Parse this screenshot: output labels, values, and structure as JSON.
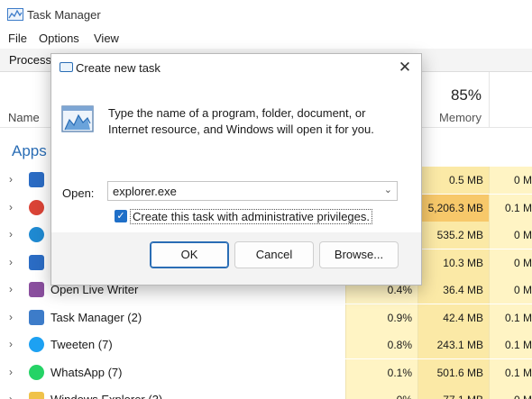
{
  "app": {
    "title": "Task Manager",
    "menus": [
      "File",
      "Options",
      "View"
    ],
    "tab": "Processe"
  },
  "columns": {
    "name": "Name",
    "memory_pct": "85%",
    "memory_label": "Memory"
  },
  "group": "Apps",
  "rows": [
    {
      "name": "",
      "cpu": "",
      "memory": "0.5 MB",
      "disk": "0 M",
      "icon": "blue-app-icon",
      "icon_color": "#2b6cc4"
    },
    {
      "name": "",
      "cpu": "",
      "memory": "5,206.3 MB",
      "disk": "0.1 M",
      "icon": "chrome-icon",
      "icon_color": "#db4437"
    },
    {
      "name": "",
      "cpu": "",
      "memory": "535.2 MB",
      "disk": "0 M",
      "icon": "edge-icon",
      "icon_color": "#1f8ad2"
    },
    {
      "name": "",
      "cpu": "",
      "memory": "10.3 MB",
      "disk": "0 M",
      "icon": "blue-app-icon",
      "icon_color": "#2b6cc4"
    },
    {
      "name": "Open Live Writer",
      "cpu": "0.4%",
      "memory": "36.4 MB",
      "disk": "0 M",
      "icon": "open-live-writer-icon",
      "icon_color": "#8a4f9e"
    },
    {
      "name": "Task Manager (2)",
      "cpu": "0.9%",
      "memory": "42.4 MB",
      "disk": "0.1 M",
      "icon": "task-manager-icon",
      "icon_color": "#3d7cc9"
    },
    {
      "name": "Tweeten (7)",
      "cpu": "0.8%",
      "memory": "243.1 MB",
      "disk": "0.1 M",
      "icon": "tweeten-icon",
      "icon_color": "#1da1f2"
    },
    {
      "name": "WhatsApp (7)",
      "cpu": "0.1%",
      "memory": "501.6 MB",
      "disk": "0.1 M",
      "icon": "whatsapp-icon",
      "icon_color": "#25d366"
    },
    {
      "name": "Windows Explorer (3)",
      "cpu": "0%",
      "memory": "77.1 MB",
      "disk": "0 M",
      "icon": "folder-icon",
      "icon_color": "#f0c24a"
    }
  ],
  "colors": {
    "accent": "#1f6fc8",
    "cpu_cell": "#fff4c4",
    "memory_cell": "#fbe9a6",
    "memory_cell_high": "#f7c86a",
    "disk_cell": "#fff4c4"
  },
  "dialog": {
    "title": "Create new task",
    "close_glyph": "✕",
    "description": "Type the name of a program, folder, document, or Internet resource, and Windows will open it for you.",
    "open_label": "Open:",
    "open_value": "explorer.exe",
    "admin_checkbox_label": "Create this task with administrative privileges.",
    "admin_checked": true,
    "buttons": {
      "ok": "OK",
      "cancel": "Cancel",
      "browse": "Browse..."
    }
  }
}
